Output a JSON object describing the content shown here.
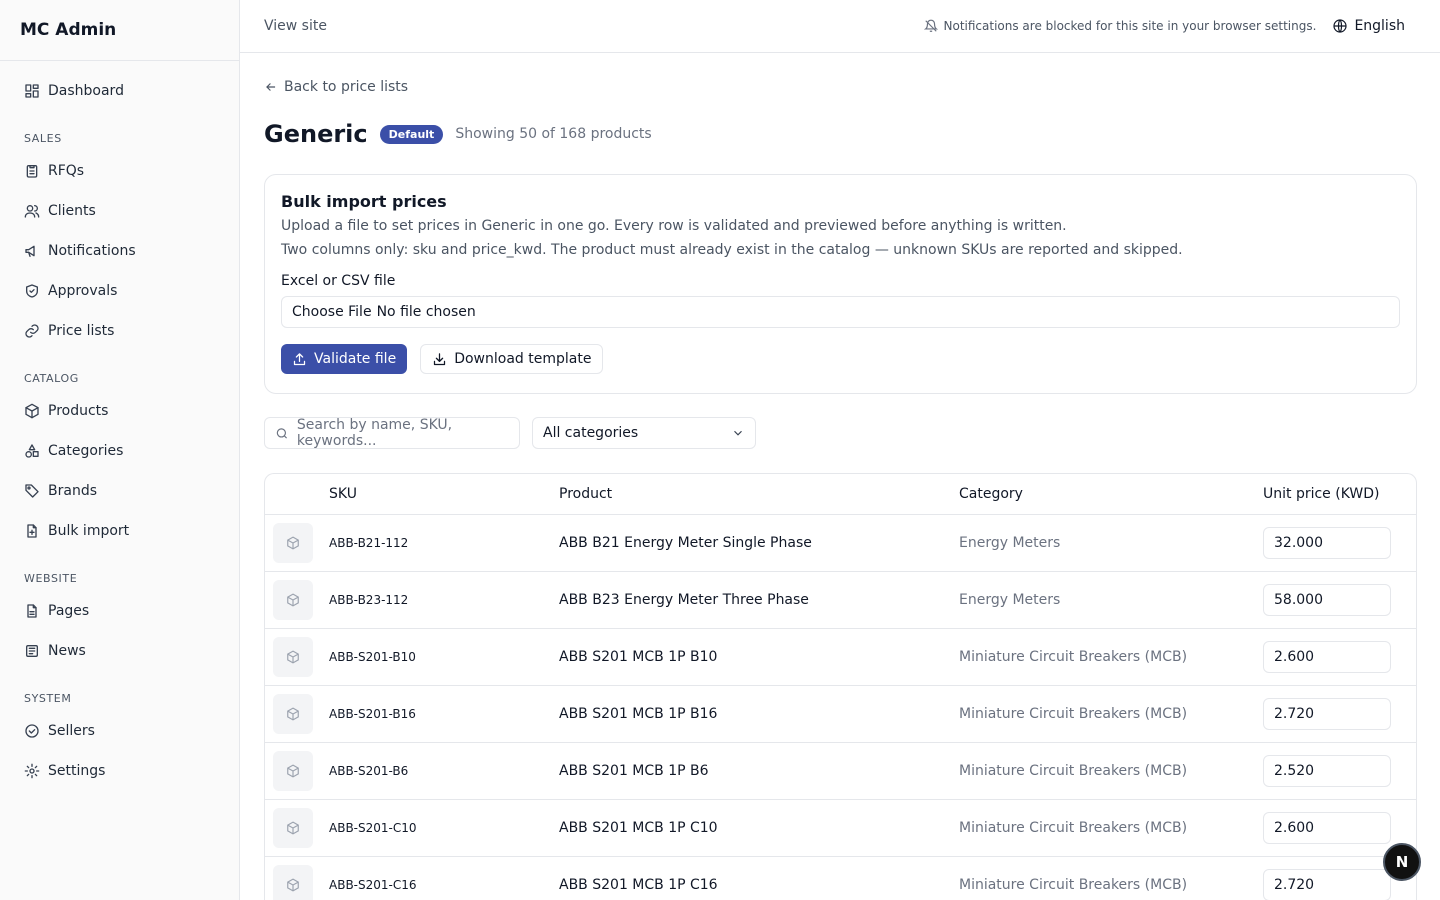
{
  "sidebar": {
    "brand": "MC Admin",
    "dashboard": "Dashboard",
    "sections": {
      "sales": "SALES",
      "catalog": "CATALOG",
      "website": "WEBSITE",
      "system": "SYSTEM"
    },
    "items": {
      "rfqs": "RFQs",
      "clients": "Clients",
      "notifications": "Notifications",
      "approvals": "Approvals",
      "price_lists": "Price lists",
      "products": "Products",
      "categories": "Categories",
      "brands": "Brands",
      "bulk_import": "Bulk import",
      "pages": "Pages",
      "news": "News",
      "sellers": "Sellers",
      "settings": "Settings"
    }
  },
  "topbar": {
    "view_site": "View site",
    "notice": "Notifications are blocked for this site in your browser settings.",
    "language": "English"
  },
  "page": {
    "back": "Back to price lists",
    "title": "Generic",
    "badge": "Default",
    "count": "Showing 50 of 168 products"
  },
  "import_card": {
    "title": "Bulk import prices",
    "desc1": "Upload a file to set prices in Generic in one go. Every row is validated and previewed before anything is written.",
    "desc2": "Two columns only: sku and price_kwd. The product must already exist in the catalog — unknown SKUs are reported and skipped.",
    "file_label": "Excel or CSV file",
    "choose_file": "Choose File",
    "no_file": "No file chosen",
    "validate_btn": "Validate file",
    "download_btn": "Download template"
  },
  "filters": {
    "search_placeholder": "Search by name, SKU, keywords...",
    "category_select": "All categories"
  },
  "table": {
    "headers": {
      "sku": "SKU",
      "product": "Product",
      "category": "Category",
      "price": "Unit price (KWD)"
    },
    "rows": [
      {
        "sku": "ABB-B21-112",
        "product": "ABB B21 Energy Meter Single Phase",
        "category": "Energy Meters",
        "price": "32.000"
      },
      {
        "sku": "ABB-B23-112",
        "product": "ABB B23 Energy Meter Three Phase",
        "category": "Energy Meters",
        "price": "58.000"
      },
      {
        "sku": "ABB-S201-B10",
        "product": "ABB S201 MCB 1P B10",
        "category": "Miniature Circuit Breakers (MCB)",
        "price": "2.600"
      },
      {
        "sku": "ABB-S201-B16",
        "product": "ABB S201 MCB 1P B16",
        "category": "Miniature Circuit Breakers (MCB)",
        "price": "2.720"
      },
      {
        "sku": "ABB-S201-B6",
        "product": "ABB S201 MCB 1P B6",
        "category": "Miniature Circuit Breakers (MCB)",
        "price": "2.520"
      },
      {
        "sku": "ABB-S201-C10",
        "product": "ABB S201 MCB 1P C10",
        "category": "Miniature Circuit Breakers (MCB)",
        "price": "2.600"
      },
      {
        "sku": "ABB-S201-C16",
        "product": "ABB S201 MCB 1P C16",
        "category": "Miniature Circuit Breakers (MCB)",
        "price": "2.720"
      }
    ]
  },
  "fab": "N"
}
